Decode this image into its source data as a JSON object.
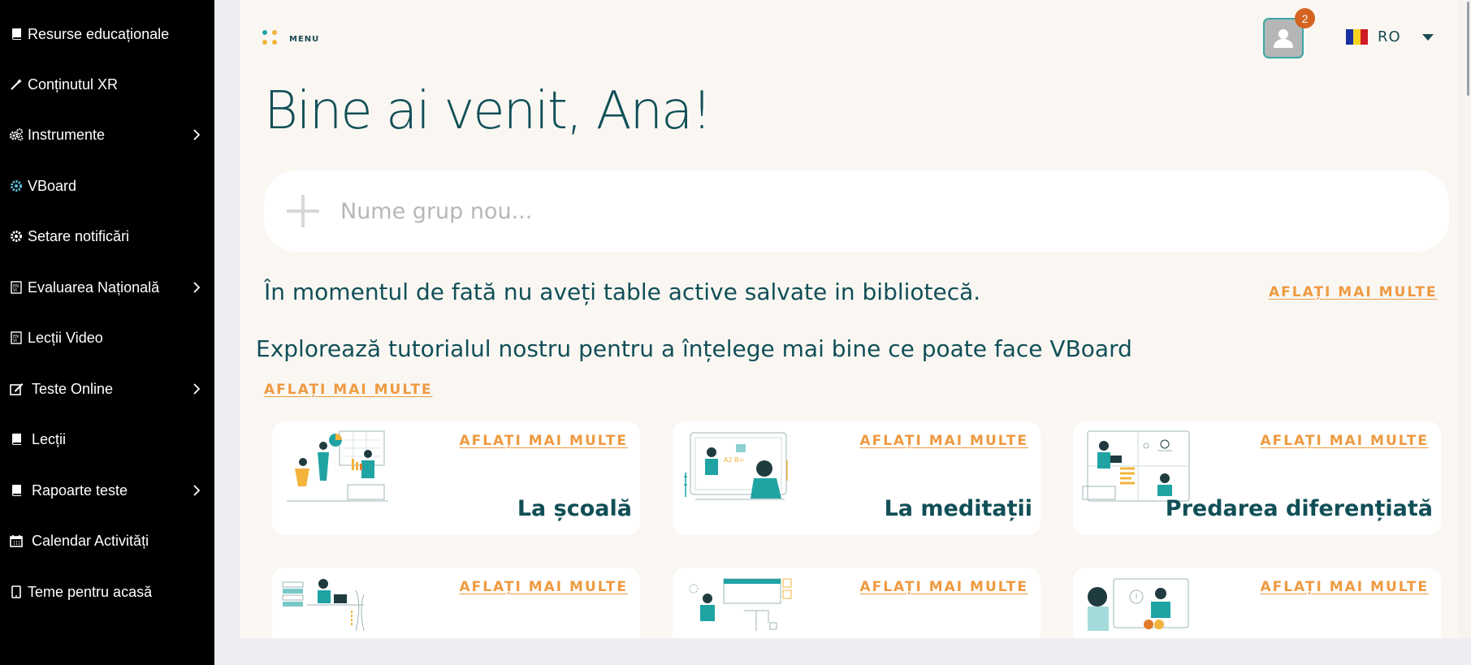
{
  "sidebar": {
    "items": [
      {
        "label": "Resurse educaționale",
        "icon": "book-icon",
        "has_submenu": false
      },
      {
        "label": "Conținutul XR",
        "icon": "magic-wand-icon",
        "has_submenu": false
      },
      {
        "label": "Instrumente",
        "icon": "gears-icon",
        "has_submenu": true
      },
      {
        "label": "VBoard",
        "icon": "gear-icon",
        "has_submenu": false
      },
      {
        "label": "Setare notificări",
        "icon": "gear-icon",
        "has_submenu": false
      },
      {
        "label": "Evaluarea Națională",
        "icon": "badge-icon",
        "has_submenu": true
      },
      {
        "label": "Lecții Video",
        "icon": "badge-icon",
        "has_submenu": false
      },
      {
        "label": "Teste Online",
        "icon": "edit-icon",
        "has_submenu": true
      },
      {
        "label": "Lecții",
        "icon": "book-icon",
        "has_submenu": false
      },
      {
        "label": "Rapoarte teste",
        "icon": "book-icon",
        "has_submenu": true
      },
      {
        "label": "Calendar Activități",
        "icon": "calendar-icon",
        "has_submenu": false
      },
      {
        "label": "Teme pentru acasă",
        "icon": "tablet-icon",
        "has_submenu": false
      }
    ]
  },
  "header": {
    "menu_label": "MENU",
    "notification_count": "2",
    "language_code": "RO"
  },
  "main": {
    "welcome": "Bine ai venit, Ana!",
    "new_group_placeholder": "Nume grup nou...",
    "no_boards_text": "În momentul de fată nu aveți table active salvate in bibliotecă.",
    "learn_more": "AFLAȚI MAI MULTE",
    "explore_text": "Explorează tutorialul nostru pentru a înțelege mai bine ce poate face VBoard",
    "cards": [
      {
        "title": "La școală",
        "link": "AFLAȚI MAI MULTE"
      },
      {
        "title": "La meditații",
        "link": "AFLAȚI MAI MULTE"
      },
      {
        "title": "Predarea diferențiată",
        "link": "AFLAȚI MAI MULTE"
      },
      {
        "title": "",
        "link": "AFLAȚI MAI MULTE"
      },
      {
        "title": "",
        "link": "AFLAȚI MAI MULTE"
      },
      {
        "title": "",
        "link": "AFLAȚI MAI MULTE"
      }
    ]
  },
  "colors": {
    "accent_teal": "#114f57",
    "accent_orange": "#ee9a41",
    "badge": "#d4641f",
    "sidebar_bg": "#000000"
  }
}
